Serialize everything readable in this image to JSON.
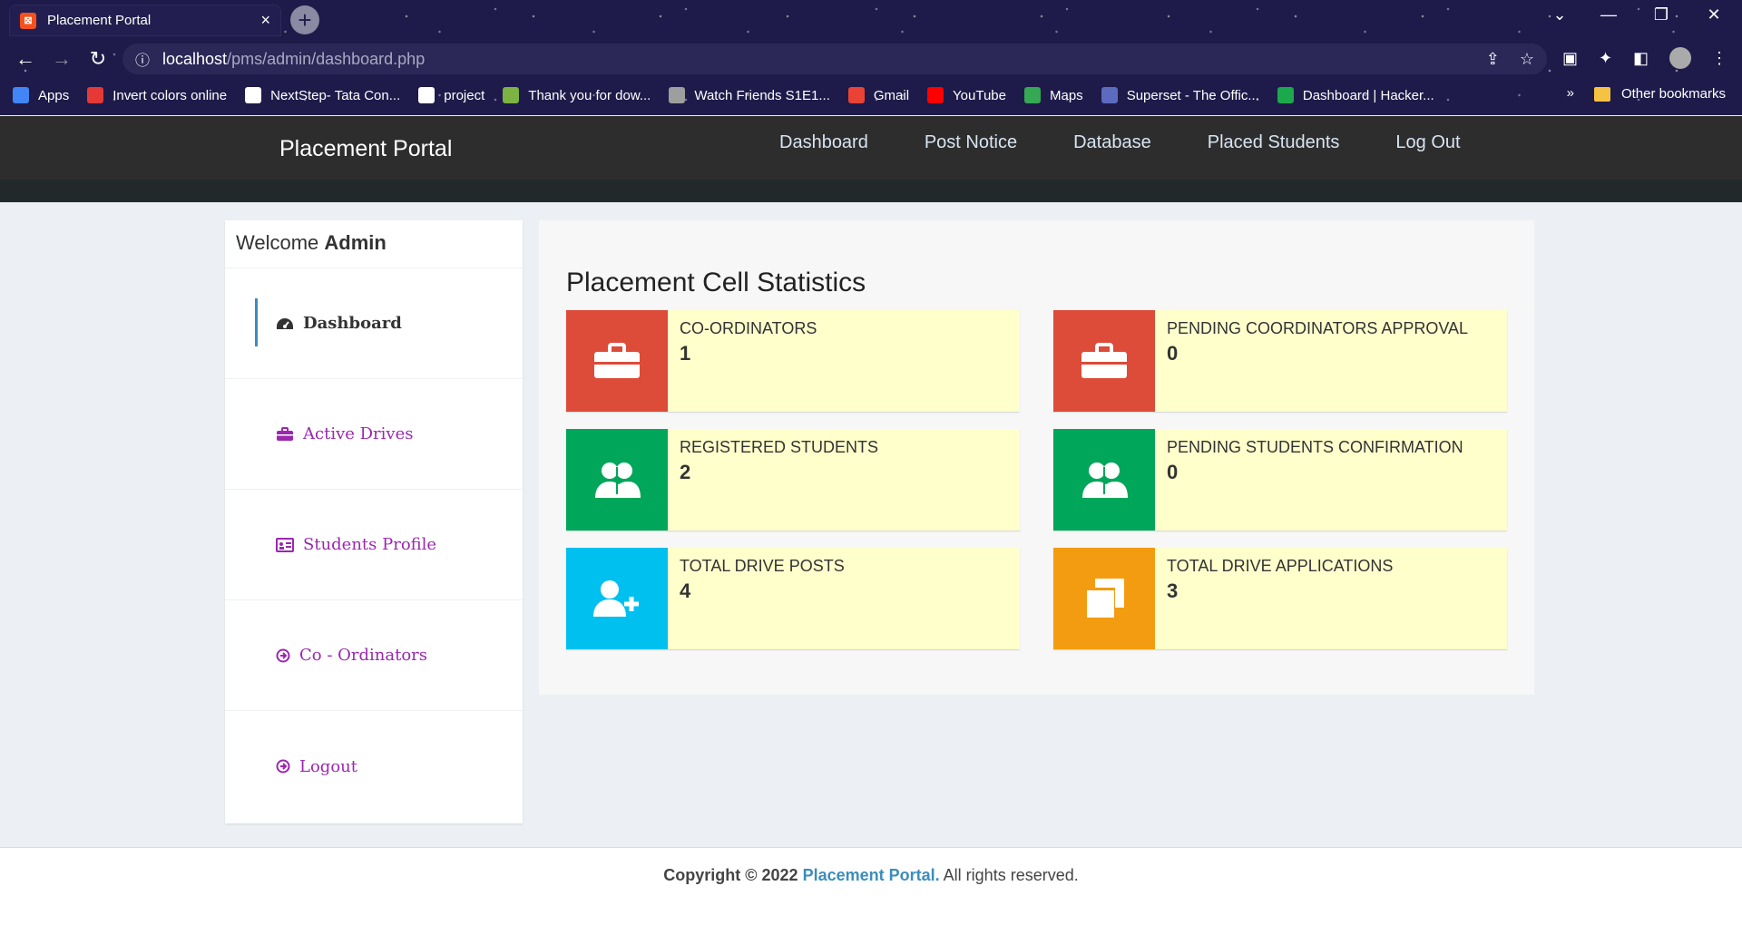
{
  "browser": {
    "tab_title": "Placement Portal",
    "url_host": "localhost",
    "url_path": "/pms/admin/dashboard.php",
    "bookmarks": [
      {
        "label": "Apps",
        "color": "#4285f4"
      },
      {
        "label": "Invert colors online",
        "color": "#e53935"
      },
      {
        "label": "NextStep- Tata Con...",
        "color": "#ffffff"
      },
      {
        "label": "project",
        "color": "#ffffff"
      },
      {
        "label": "Thank you for dow...",
        "color": "#7cb342"
      },
      {
        "label": "Watch Friends S1E1...",
        "color": "#9e9e9e"
      },
      {
        "label": "Gmail",
        "color": "#ea4335"
      },
      {
        "label": "YouTube",
        "color": "#ff0000"
      },
      {
        "label": "Maps",
        "color": "#34a853"
      },
      {
        "label": "Superset - The Offic...",
        "color": "#5c6bc0"
      },
      {
        "label": "Dashboard | Hacker...",
        "color": "#1ba94c"
      }
    ],
    "bookmarks_more": "»",
    "other_bookmarks": "Other bookmarks"
  },
  "nav": {
    "brand": "Placement Portal",
    "links": [
      "Dashboard",
      "Post Notice",
      "Database",
      "Placed Students",
      "Log Out"
    ]
  },
  "sidebar": {
    "welcome_prefix": "Welcome",
    "welcome_user": "Admin",
    "items": [
      {
        "label": "Dashboard",
        "icon": "dashboard-icon"
      },
      {
        "label": "Active Drives",
        "icon": "briefcase-icon"
      },
      {
        "label": "Students Profile",
        "icon": "id-card-icon"
      },
      {
        "label": "Co - Ordinators",
        "icon": "arrow-circle-icon"
      },
      {
        "label": "Logout",
        "icon": "arrow-circle-icon"
      }
    ]
  },
  "main": {
    "title": "Placement Cell Statistics",
    "stats": [
      {
        "label": "CO-ORDINATORS",
        "value": "1",
        "color": "#dd4b39",
        "icon": "briefcase-icon"
      },
      {
        "label": "PENDING COORDINATORS APPROVAL",
        "value": "0",
        "color": "#dd4b39",
        "icon": "briefcase-icon"
      },
      {
        "label": "REGISTERED STUDENTS",
        "value": "2",
        "color": "#00a65a",
        "icon": "users-icon"
      },
      {
        "label": "PENDING STUDENTS CONFIRMATION",
        "value": "0",
        "color": "#00a65a",
        "icon": "users-icon"
      },
      {
        "label": "TOTAL DRIVE POSTS",
        "value": "4",
        "color": "#00c0ef",
        "icon": "user-plus-icon"
      },
      {
        "label": "TOTAL DRIVE APPLICATIONS",
        "value": "3",
        "color": "#f39c12",
        "icon": "copy-icon"
      }
    ]
  },
  "footer": {
    "prefix": "Copyright © 2022",
    "brand": "Placement Portal.",
    "suffix": "All rights reserved."
  }
}
